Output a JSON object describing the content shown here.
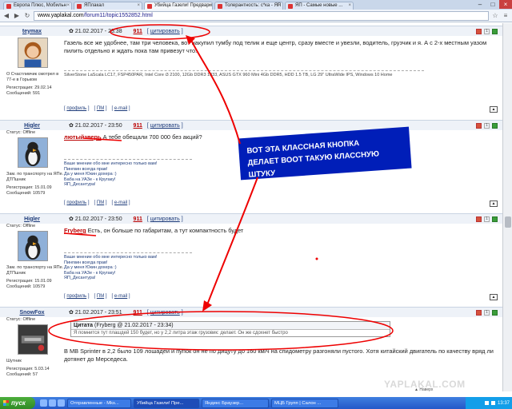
{
  "tabs": [
    {
      "label": "Европа Плюс, Мобильн"
    },
    {
      "label": "ЯПлакал"
    },
    {
      "label": "Убийца Газели! Предвари"
    },
    {
      "label": "Толерантность: с*ка - ЯП"
    },
    {
      "label": "ЯП - Самые новые ..."
    }
  ],
  "window": {
    "min": "–",
    "max": "□",
    "close": "×"
  },
  "address": {
    "prefix": "www.yaplakal.com",
    "path": "/forum11/topic1552852.html"
  },
  "posts": [
    {
      "nick": "teymax",
      "date": "21.02.2017 - 23:38",
      "num": "911",
      "quote_btn": "цитировать",
      "status": "О Счастливчик смотрел в 77-е в Горьком",
      "reg_date": "Регистрация: 29.02.14",
      "msgs": "Сообщений: 591",
      "text": "Газель все же удобнее, там три человека, вот накупил тумбу под телик и еще центр, сразу вместе и увезли, водитель, грузчик и я. А с 2-х местным уазом пилить отдельно и ждать пока там привезут что.",
      "sig": "SilverStone LaScala LC17, FSP450PAR, Intel Core i3 2100, 12Gb DDR3 1333, ASUS GTX 960 Mini 4Gb DDR5, HDD 1.5 TB, LG 29\" UltraWide IPS, Windows 10 Home"
    },
    {
      "nick": "Higler",
      "date": "21.02.2017 - 23:50",
      "num": "911",
      "quote_btn": "цитировать",
      "status": "Статус: Offline",
      "desc": "Зам. по транспорту на ЯПе. ДТПшник",
      "reg_date": "Регистрация: 15.01.09",
      "msgs": "Сообщений: 10579",
      "user_ref": "лютыйзверь",
      "text": " А тебе обещали 700 000 без акций?",
      "sig": [
        "Ваше мнение обо мне интересно только вам!",
        "Пингвин всегда прав!",
        "Да у меня Юкин дохера :)",
        "Баба на УАЗе - к Кругаку!",
        "ЯП_Десантура!"
      ]
    },
    {
      "nick": "Higler",
      "date": "21.02.2017 - 23:50",
      "num": "911",
      "quote_btn": "цитировать",
      "status": "Статус: Offline",
      "desc": "Зам. по транспорту на ЯПе. ДТПшник",
      "reg_date": "Регистрация: 15.01.09",
      "msgs": "Сообщений: 10579",
      "user_ref": "Fryberg",
      "text": " Есть, он больше по габаритам, а тут компактность будет",
      "sig": [
        "Ваше мнение обо мне интересно только вам!",
        "Пингвин всегда прав!",
        "Да у меня Юкин дохера :)",
        "Баба на УАЗе - к Кругаку!",
        "ЯП_Десантура!"
      ]
    },
    {
      "nick": "SnowFox",
      "date": "21.02.2017 - 23:51",
      "num": "911",
      "quote_btn": "цитировать",
      "status": "Статус: Offline",
      "desc": "Шутник",
      "reg_date": "Регистрация: 5.03.14",
      "msgs": "Сообщений: 57",
      "quote_title": "Цитата",
      "quote_src": "(Fryberg @ 21.02.2017 - 23:34)",
      "quote_text": "Я помнится тут плашдей 150 будет, но у 2,2 литра этаж грузовик: делает. Он же сдохнет быстро",
      "text": "В MB Sprinter в 2,2 было 109 лошадей и пупок он не по дицуту до 160 км/ч на спидометру разгоняли пустого. Хотя китайский двигатель по качеству вряд ли дотянет до Мерседеса."
    }
  ],
  "footer_links": {
    "profile": "профиль",
    "pm": "ПМ",
    "email": "e-mail"
  },
  "callout": {
    "line1": "ВОТ ЭТА КЛАССНАЯ КНОПКА",
    "line2": "ДЕЛАЕТ ВООТ ТАКУЮ КЛАССНУЮ ШТУКУ"
  },
  "watermark": "YAPLAKAL.COM",
  "naverh": "Наверх",
  "taskbar": {
    "start": "пуск",
    "buttons": [
      "Отправленные - Mks...",
      "Убийца Газели! Пре...",
      "Яндекс Браузер...",
      "МЦБ Групп | Салон ..."
    ],
    "time": "13:37"
  }
}
